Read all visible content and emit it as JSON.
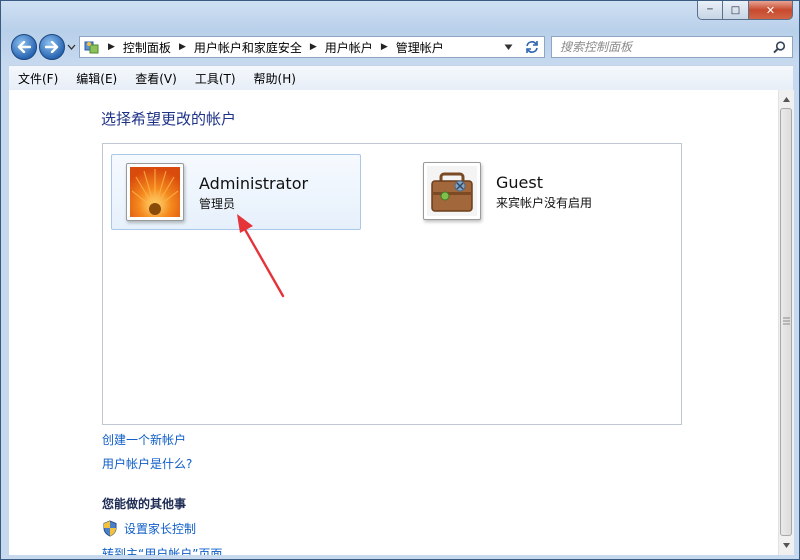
{
  "window": {
    "caption_minimize": "─",
    "caption_maximize": "□",
    "caption_close": "✕"
  },
  "nav": {
    "breadcrumbs": [
      "控制面板",
      "用户帐户和家庭安全",
      "用户帐户",
      "管理帐户"
    ],
    "search_placeholder": "搜索控制面板"
  },
  "menu": [
    "文件(F)",
    "编辑(E)",
    "查看(V)",
    "工具(T)",
    "帮助(H)"
  ],
  "main": {
    "heading": "选择希望更改的帐户",
    "accounts": [
      {
        "name": "Administrator",
        "role": "管理员"
      },
      {
        "name": "Guest",
        "role": "来宾帐户没有启用"
      }
    ],
    "links": [
      "创建一个新帐户",
      "用户帐户是什么?"
    ],
    "other_heading": "您能做的其他事",
    "other_links": [
      "设置家长控制",
      "转到主“用户帐户”页面"
    ]
  },
  "colors": {
    "link": "#0f5ec8",
    "heading": "#1e3287",
    "annotation_arrow": "#e5333a"
  }
}
